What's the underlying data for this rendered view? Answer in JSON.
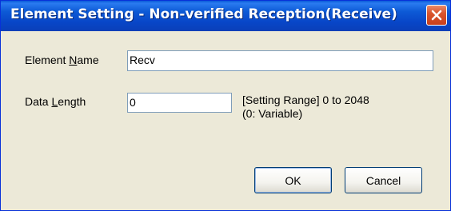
{
  "window": {
    "title": "Element Setting - Non-verified Reception(Receive)"
  },
  "form": {
    "element_name": {
      "label_pre": "Element ",
      "label_accel": "N",
      "label_post": "ame",
      "value": "Recv"
    },
    "data_length": {
      "label_pre": "Data ",
      "label_accel": "L",
      "label_post": "ength",
      "value": "0",
      "range_line1": "[Setting Range] 0 to 2048",
      "range_line2": "(0: Variable)"
    }
  },
  "buttons": {
    "ok": "OK",
    "cancel": "Cancel"
  },
  "icons": {
    "close": "close-icon"
  },
  "colors": {
    "titlebar": "#0a4fd0",
    "dialog_bg": "#ece9d8",
    "close_button": "#d9552d"
  }
}
